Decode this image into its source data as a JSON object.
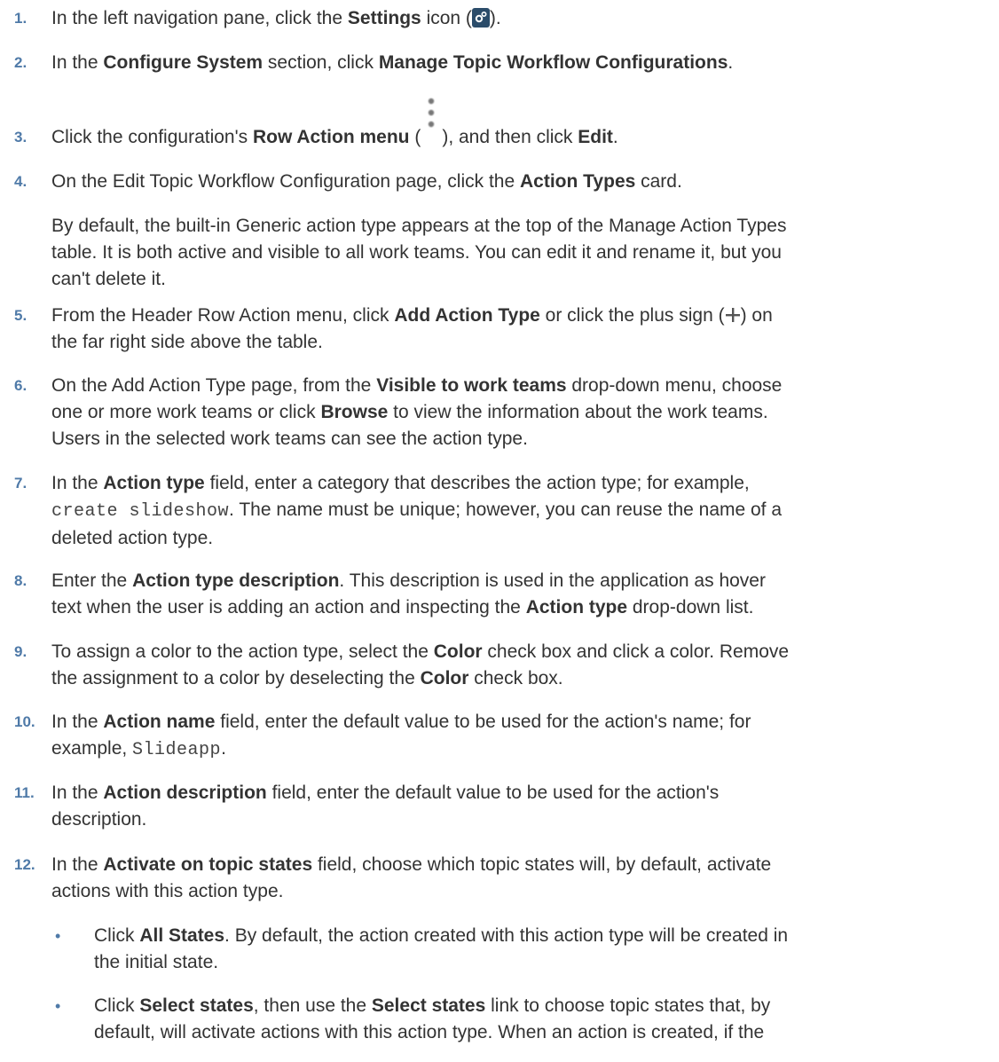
{
  "steps": [
    {
      "n": "1.",
      "a": "In the left navigation pane, click the ",
      "b1": "Settings",
      "c": " icon (",
      "d": ")."
    },
    {
      "n": "2.",
      "a": "In the ",
      "b1": "Configure System",
      "c": " section, click ",
      "b2": "Manage Topic Workflow Configurations",
      "d": "."
    },
    {
      "n": "3.",
      "a": "Click the configuration's ",
      "b1": "Row Action menu",
      "c": " (",
      "d": "), and then click ",
      "b2": "Edit",
      "e": "."
    },
    {
      "n": "4.",
      "a": "On the Edit Topic Workflow Configuration page, click the ",
      "b1": "Action Types",
      "c": " card."
    },
    {
      "n": "5.",
      "a": "From the Header Row Action menu, click ",
      "b1": "Add Action Type",
      "c": " or click the plus sign (",
      "d": ") on",
      "line2": "the far right side above the table."
    },
    {
      "n": "6.",
      "a": "On the Add Action Type page, from the ",
      "b1": "Visible to work teams",
      "c": " drop-down menu, choose",
      "l2a": "one or more work teams or click ",
      "l2b": "Browse",
      "l2c": " to view the information about the work teams.",
      "line3": "Users in the selected work teams can see the action type."
    },
    {
      "n": "7.",
      "a": "In the ",
      "b1": "Action type",
      "c": " field, enter a category that describes the action type; for example,",
      "code": "create slideshow",
      "l2c": ". The name must be unique; however, you can reuse the name of a",
      "line3": "deleted action type."
    },
    {
      "n": "8.",
      "a": "Enter the ",
      "b1": "Action type description",
      "c": ". This description is used in the application as hover",
      "l2a": "text when the user is adding an action and inspecting the ",
      "l2b": "Action type",
      "l2c": " drop-down list."
    },
    {
      "n": "9.",
      "a": "To assign a color to the action type, select the ",
      "b1": "Color",
      "c": " check box and click a color. Remove",
      "l2a": "the assignment to a color by deselecting the ",
      "l2b": "Color",
      "l2c": " check box."
    },
    {
      "n": "10.",
      "a": "In the ",
      "b1": "Action name",
      "c": " field, enter the default value to be used for the action's name; for",
      "l2a": "example, ",
      "code": "Slideapp",
      "l2c": "."
    },
    {
      "n": "11.",
      "a": "In the ",
      "b1": "Action description",
      "c": " field, enter the default value to be used for the action's",
      "line2": "description."
    },
    {
      "n": "12.",
      "a": "In the ",
      "b1": "Activate on topic states",
      "c": " field, choose which topic states will, by default, activate",
      "line2": "actions with this action type."
    }
  ],
  "note": {
    "line1": "By default, the built-in Generic action type appears at the top of the Manage Action Types",
    "line2": "table. It is both active and visible to all work teams. You can edit it and rename it, but you",
    "line3": "can't delete it."
  },
  "bullets": [
    {
      "bullet": "•",
      "a": "Click ",
      "b1": "All States",
      "c": ". By default, the action created with this action type will be created in",
      "line2": "the initial state."
    },
    {
      "bullet": "•",
      "a": "Click ",
      "b1": "Select states",
      "c": ", then use the ",
      "b2": "Select states",
      "d": " link to choose topic states that, by",
      "line2": "default, will activate actions with this action type. When an action is created, if the"
    }
  ],
  "icons": {
    "settings": "gear-icon",
    "row_action": "kebab-menu-icon",
    "add": "plus-icon"
  },
  "colors": {
    "step_number": "#4f7aa8",
    "text": "#333333",
    "settings_icon_bg": "#2b4c6a"
  }
}
